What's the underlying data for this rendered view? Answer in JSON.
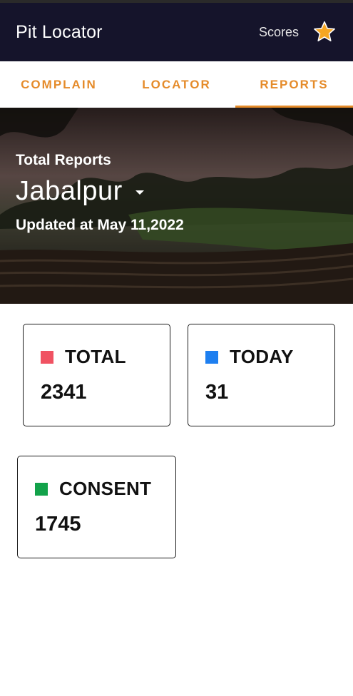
{
  "app": {
    "title": "Pit Locator",
    "scores_label": "Scores",
    "star_icon": "star-icon"
  },
  "tabs": [
    {
      "label": "COMPLAIN",
      "active": false
    },
    {
      "label": "LOCATOR",
      "active": false
    },
    {
      "label": "REPORTS",
      "active": true
    }
  ],
  "hero": {
    "label": "Total Reports",
    "city": "Jabalpur",
    "updated": "Updated at May 11,2022"
  },
  "cards": [
    {
      "title": "TOTAL",
      "value": "2341",
      "color": "#f05262"
    },
    {
      "title": "TODAY",
      "value": "31",
      "color": "#1e7ff0"
    },
    {
      "title": "CONSENT",
      "value": "1745",
      "color": "#12a24a"
    }
  ],
  "colors": {
    "appbar": "#15142b",
    "accent": "#e58b2a",
    "star": "#f5a623"
  }
}
